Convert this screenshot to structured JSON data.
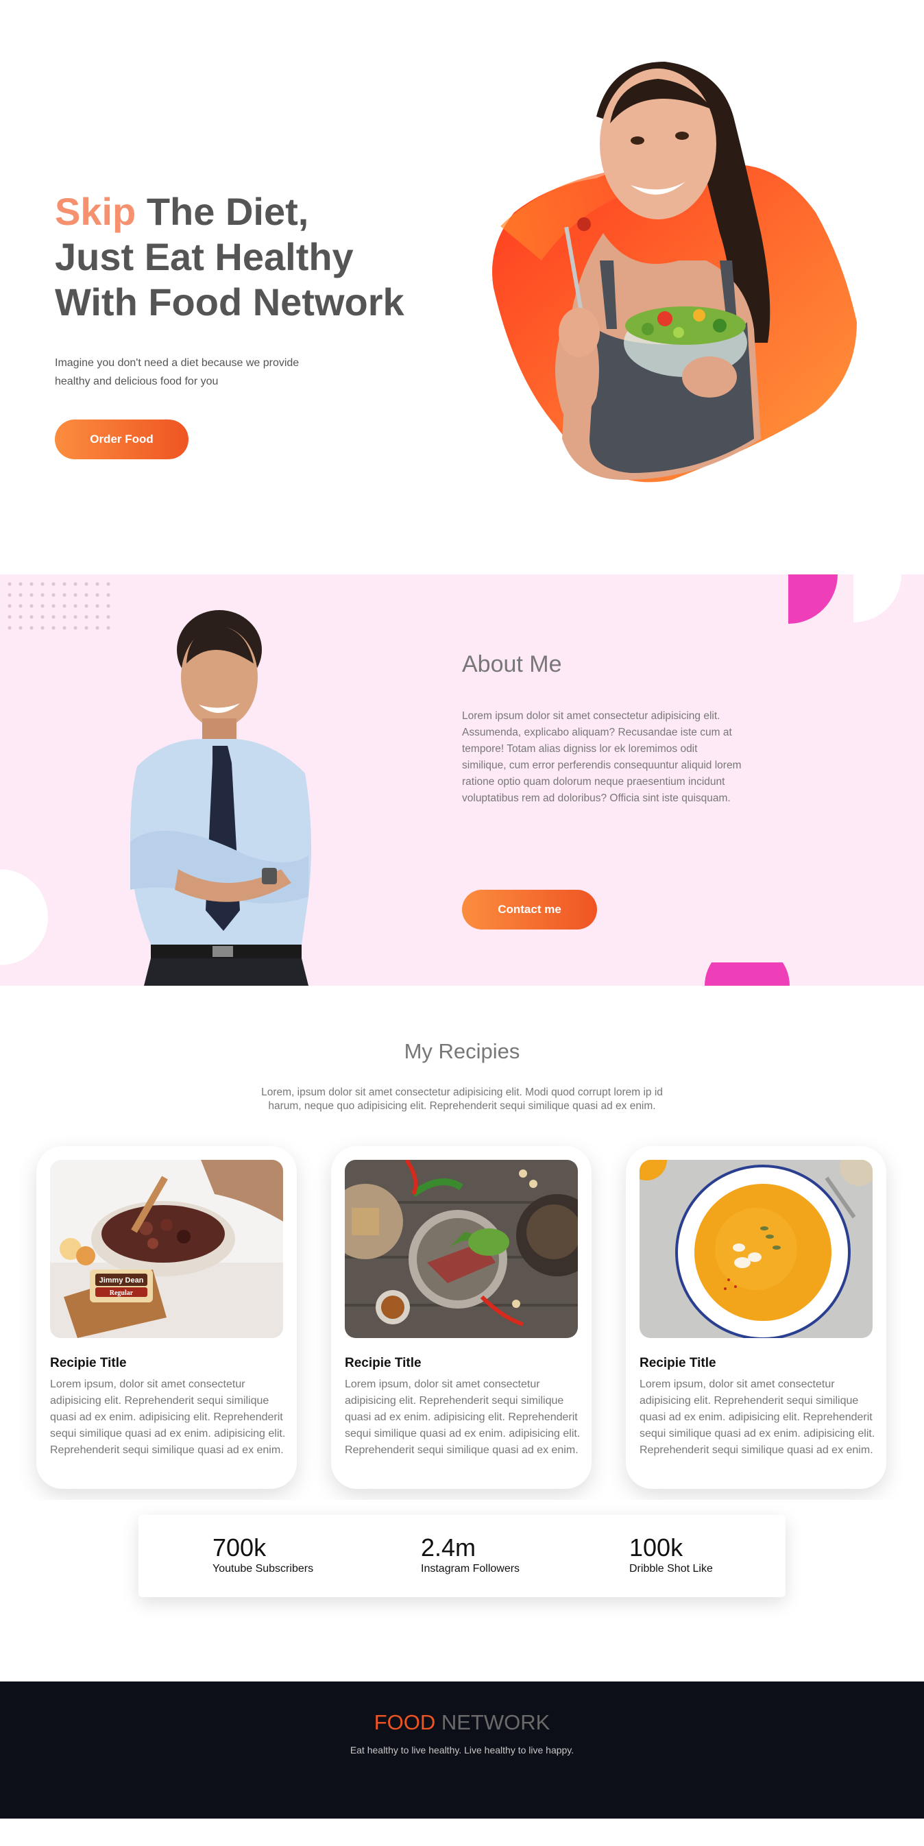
{
  "hero": {
    "title_accent": "Skip",
    "title_line1_rest": " The Diet,",
    "title_line2": "Just Eat Healthy",
    "title_line3": "With Food Network",
    "subtitle": "Imagine you don't need a diet because we provide healthy and delicious food for you",
    "order_button": "Order Food"
  },
  "about": {
    "title": "About Me",
    "body": "Lorem ipsum dolor sit amet consectetur adipisicing elit. Assumenda, explicabo aliquam? Recusandae iste cum at tempore! Totam alias digniss lor ek loremimos odit similique, cum error perferendis consequuntur aliquid lorem ratione optio quam dolorum neque praesentium incidunt voluptatibus rem ad doloribus? Officia sint iste quisquam.",
    "contact_button": "Contact me"
  },
  "recipes": {
    "title": "My Recipies",
    "intro": "Lorem, ipsum dolor sit amet consectetur adipisicing elit. Modi quod corrupt lorem ip id harum, neque quo adipisicing elit. Reprehenderit sequi similique quasi ad ex enim.",
    "cards": [
      {
        "title": "Recipie Title",
        "text": "Lorem ipsum, dolor sit amet consectetur adipisicing elit. Reprehenderit sequi similique quasi ad ex enim. adipisicing elit. Reprehenderit sequi similique quasi ad ex enim. adipisicing elit. Reprehenderit sequi similique quasi ad ex enim."
      },
      {
        "title": "Recipie Title",
        "text": "Lorem ipsum, dolor sit amet consectetur adipisicing elit. Reprehenderit sequi similique quasi ad ex enim. adipisicing elit. Reprehenderit sequi similique quasi ad ex enim. adipisicing elit. Reprehenderit sequi similique quasi ad ex enim."
      },
      {
        "title": "Recipie Title",
        "text": "Lorem ipsum, dolor sit amet consectetur adipisicing elit. Reprehenderit sequi similique quasi ad ex enim. adipisicing elit. Reprehenderit sequi similique quasi ad ex enim. adipisicing elit. Reprehenderit sequi similique quasi ad ex enim."
      }
    ],
    "package_label_top": "Jimmy Dean",
    "package_label_bottom": "Regular"
  },
  "stats": [
    {
      "value": "700k",
      "label": "Youtube Subscribers"
    },
    {
      "value": "2.4m",
      "label": "Instagram Followers"
    },
    {
      "value": "100k",
      "label": "Dribble Shot Like"
    }
  ],
  "footer": {
    "brand_part1": "FOOD",
    "brand_part2": " NETWORK",
    "tagline": "Eat healthy to live healthy. Live healthy to live happy."
  },
  "colors": {
    "accent_orange": "#ef5523",
    "accent_light": "#fb8d3f",
    "pink_bg": "#fdeaf6",
    "magenta": "#f03cb8",
    "footer_bg": "#0d0f18"
  }
}
